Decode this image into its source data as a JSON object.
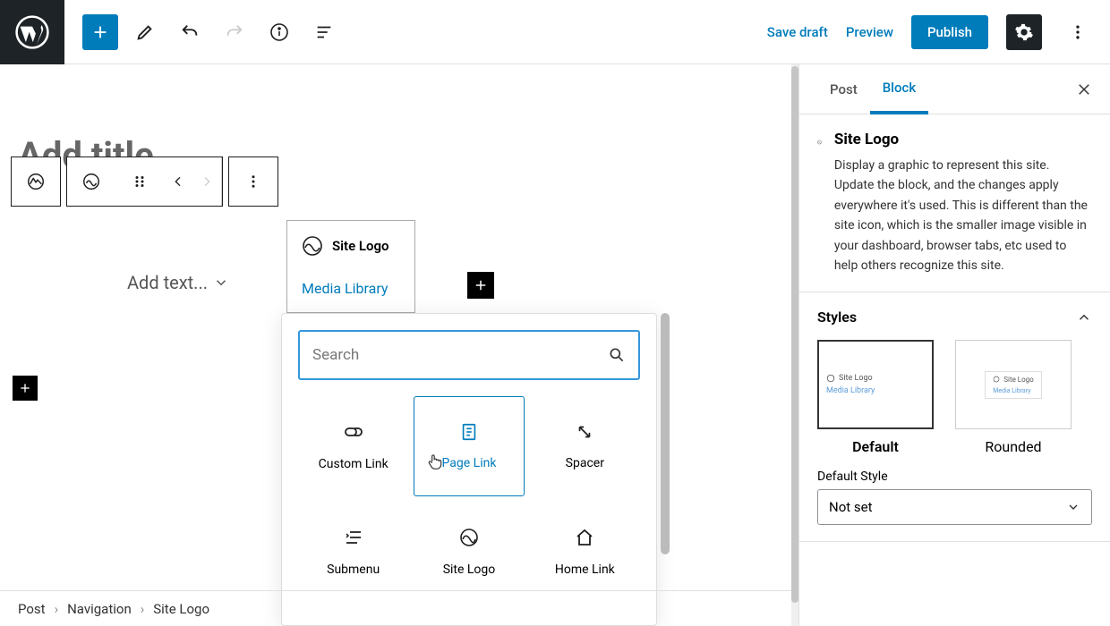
{
  "topbar": {
    "save_draft": "Save draft",
    "preview": "Preview",
    "publish": "Publish"
  },
  "canvas": {
    "title_placeholder": "Add title",
    "add_text": "Add text...",
    "site_logo_card": {
      "title": "Site Logo",
      "media_link": "Media Library"
    }
  },
  "inserter": {
    "search_placeholder": "Search",
    "blocks": [
      {
        "label": "Custom Link",
        "icon": "link-icon"
      },
      {
        "label": "Page Link",
        "icon": "page-icon",
        "selected": true
      },
      {
        "label": "Spacer",
        "icon": "spacer-icon"
      },
      {
        "label": "Submenu",
        "icon": "submenu-icon"
      },
      {
        "label": "Site Logo",
        "icon": "logo-icon"
      },
      {
        "label": "Home Link",
        "icon": "home-icon"
      }
    ]
  },
  "sidebar": {
    "tabs": {
      "post": "Post",
      "block": "Block"
    },
    "block_title": "Site Logo",
    "block_description": "Display a graphic to represent this site. Update the block, and the changes apply everywhere it's used. This is different than the site icon, which is the smaller image visible in your dashboard, browser tabs, etc used to help others recognize this site.",
    "styles_label": "Styles",
    "style_options": [
      "Default",
      "Rounded"
    ],
    "style_thumb_label": "Site Logo",
    "style_thumb_link": "Media Library",
    "default_style_label": "Default Style",
    "default_style_value": "Not set"
  },
  "breadcrumb": [
    "Post",
    "Navigation",
    "Site Logo"
  ]
}
